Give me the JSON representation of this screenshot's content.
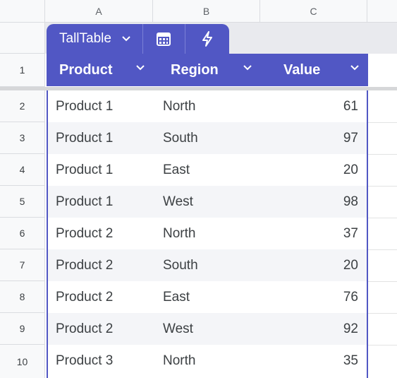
{
  "columns": [
    "A",
    "B",
    "C"
  ],
  "table": {
    "name": "TallTable",
    "headers": [
      "Product",
      "Region",
      "Value"
    ],
    "header_color": "#5157c4",
    "rows": [
      {
        "row": "2",
        "product": "Product 1",
        "region": "North",
        "value": "61"
      },
      {
        "row": "3",
        "product": "Product 1",
        "region": "South",
        "value": "97"
      },
      {
        "row": "4",
        "product": "Product 1",
        "region": "East",
        "value": "20"
      },
      {
        "row": "5",
        "product": "Product 1",
        "region": "West",
        "value": "98"
      },
      {
        "row": "6",
        "product": "Product 2",
        "region": "North",
        "value": "37"
      },
      {
        "row": "7",
        "product": "Product 2",
        "region": "South",
        "value": "20"
      },
      {
        "row": "8",
        "product": "Product 2",
        "region": "East",
        "value": "76"
      },
      {
        "row": "9",
        "product": "Product 2",
        "region": "West",
        "value": "92"
      },
      {
        "row": "10",
        "product": "Product 3",
        "region": "North",
        "value": "35"
      }
    ]
  },
  "header_row_number": "1",
  "icons": {
    "name_menu": "chevron-down-icon",
    "summary": "calculator-icon",
    "actions": "lightning-icon",
    "column_menu": "chevron-down-icon"
  }
}
